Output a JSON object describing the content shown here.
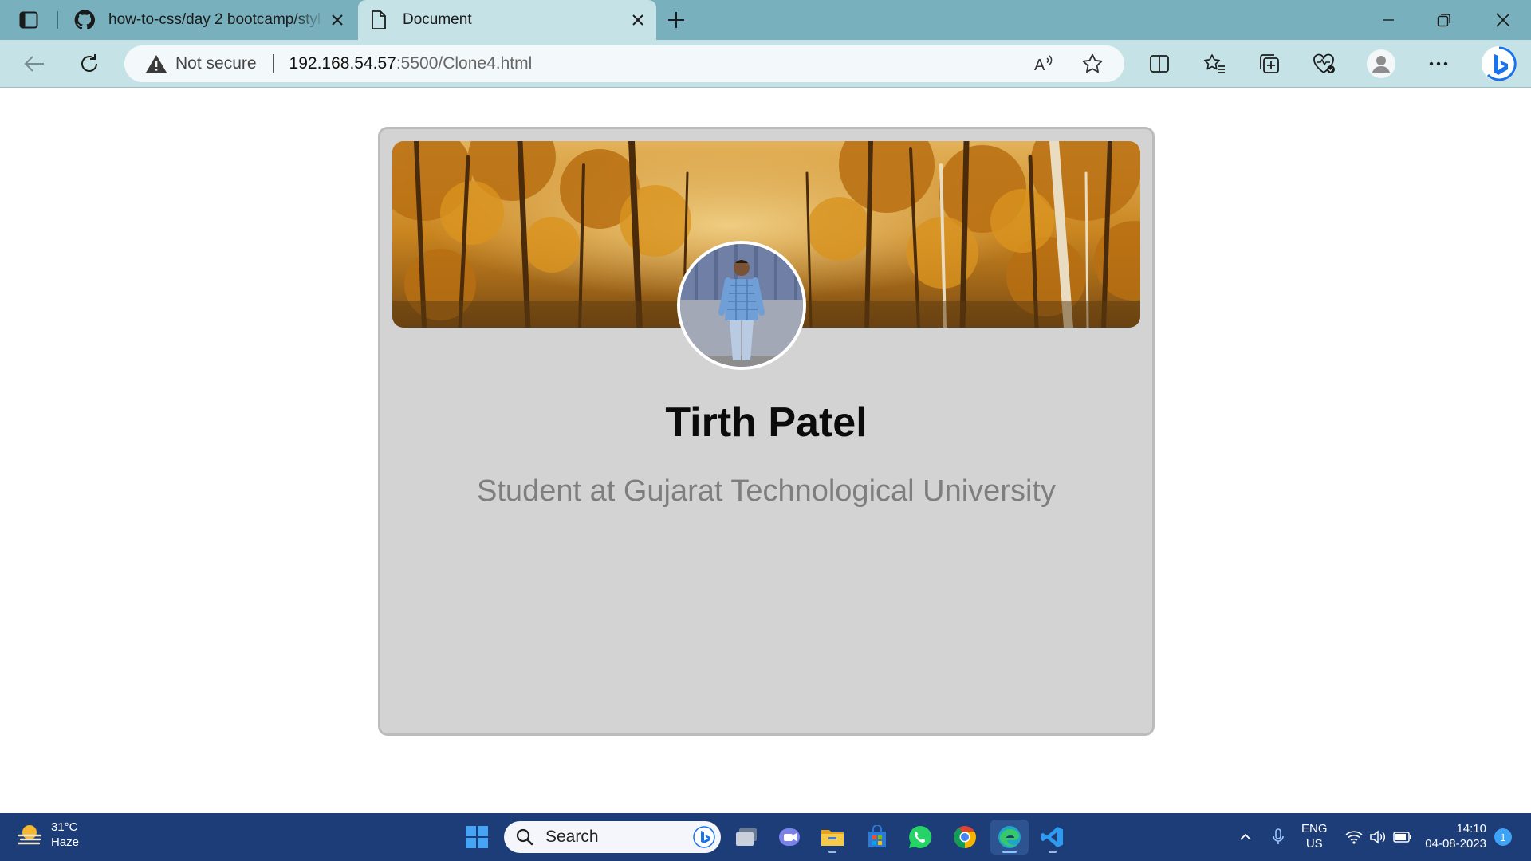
{
  "browser": {
    "tabs": [
      {
        "label": "how-to-css/day 2 bootcamp/styl",
        "icon": "github-icon",
        "active": false
      },
      {
        "label": "Document",
        "icon": "document-icon",
        "active": true
      }
    ],
    "address": {
      "security_label": "Not secure",
      "host": "192.168.54.57",
      "path": ":5500/Clone4.html"
    }
  },
  "profile_card": {
    "name": "Tirth Patel",
    "subtitle": "Student at Gujarat Technological University"
  },
  "taskbar": {
    "weather": {
      "temperature": "31°C",
      "condition": "Haze"
    },
    "search_placeholder": "Search",
    "language": {
      "line1": "ENG",
      "line2": "US"
    },
    "clock": {
      "time": "14:10",
      "date": "04-08-2023"
    },
    "notification_count": "1"
  },
  "colors": {
    "titlebar": "#78b1bd",
    "toolbar": "#c5e2e6",
    "card_background": "#d3d3d3",
    "taskbar": "#1c3d78"
  }
}
